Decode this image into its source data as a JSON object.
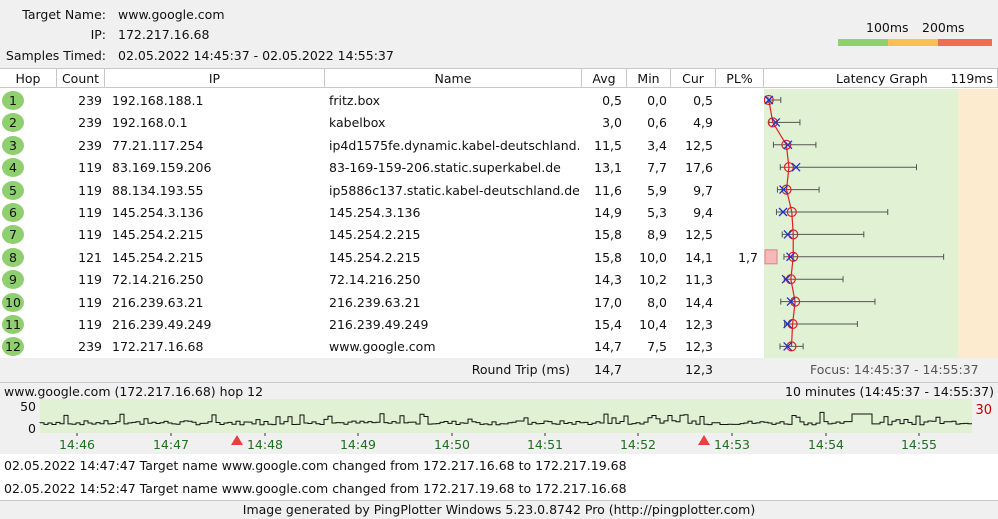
{
  "header": {
    "target_label": "Target Name:",
    "target_value": "www.google.com",
    "ip_label": "IP:",
    "ip_value": "172.217.16.68",
    "samples_label": "Samples Timed:",
    "samples_value": "02.05.2022 14:45:37 - 02.05.2022 14:55:37"
  },
  "legend": {
    "label_100": "100ms",
    "label_200": "200ms",
    "colors": [
      "#8fcf70",
      "#f9c154",
      "#f36b50"
    ]
  },
  "columns": {
    "hop": "Hop",
    "count": "Count",
    "ip": "IP",
    "name": "Name",
    "avg": "Avg",
    "min": "Min",
    "cur": "Cur",
    "pl": "PL%",
    "graph": "Latency Graph",
    "graph_max": "119ms"
  },
  "hops": [
    {
      "hop": "1",
      "count": "239",
      "ip": "192.168.188.1",
      "name": "fritz.box",
      "avg": "0,5",
      "min": "0,0",
      "cur": "0,5",
      "pl": "",
      "avg_ms": 0.5,
      "min_ms": 0.0,
      "cur_ms": 0.5,
      "max_ms": 8
    },
    {
      "hop": "2",
      "count": "239",
      "ip": "192.168.0.1",
      "name": "kabelbox",
      "avg": "3,0",
      "min": "0,6",
      "cur": "4,9",
      "pl": "",
      "avg_ms": 3.0,
      "min_ms": 0.6,
      "cur_ms": 4.9,
      "max_ms": 20
    },
    {
      "hop": "3",
      "count": "239",
      "ip": "77.21.117.254",
      "name": "ip4d1575fe.dynamic.kabel-deutschland.",
      "avg": "11,5",
      "min": "3,4",
      "cur": "12,5",
      "pl": "",
      "avg_ms": 11.5,
      "min_ms": 3.4,
      "cur_ms": 12.5,
      "max_ms": 30
    },
    {
      "hop": "4",
      "count": "119",
      "ip": "83.169.159.206",
      "name": "83-169-159-206.static.superkabel.de",
      "avg": "13,1",
      "min": "7,7",
      "cur": "17,6",
      "pl": "",
      "avg_ms": 13.1,
      "min_ms": 7.7,
      "cur_ms": 17.6,
      "max_ms": 93
    },
    {
      "hop": "5",
      "count": "119",
      "ip": "88.134.193.55",
      "name": "ip5886c137.static.kabel-deutschland.de",
      "avg": "11,6",
      "min": "5,9",
      "cur": "9,7",
      "pl": "",
      "avg_ms": 11.6,
      "min_ms": 5.9,
      "cur_ms": 9.7,
      "max_ms": 32
    },
    {
      "hop": "6",
      "count": "119",
      "ip": "145.254.3.136",
      "name": "145.254.3.136",
      "avg": "14,9",
      "min": "5,3",
      "cur": "9,4",
      "pl": "",
      "avg_ms": 14.9,
      "min_ms": 5.3,
      "cur_ms": 9.4,
      "max_ms": 75
    },
    {
      "hop": "7",
      "count": "119",
      "ip": "145.254.2.215",
      "name": "145.254.2.215",
      "avg": "15,8",
      "min": "8,9",
      "cur": "12,5",
      "pl": "",
      "avg_ms": 15.8,
      "min_ms": 8.9,
      "cur_ms": 12.5,
      "max_ms": 60
    },
    {
      "hop": "8",
      "count": "121",
      "ip": "145.254.2.215",
      "name": "145.254.2.215",
      "avg": "15,8",
      "min": "10,0",
      "cur": "14,1",
      "pl": "1,7",
      "avg_ms": 15.8,
      "min_ms": 10.0,
      "cur_ms": 14.1,
      "max_ms": 110
    },
    {
      "hop": "9",
      "count": "119",
      "ip": "72.14.216.250",
      "name": "72.14.216.250",
      "avg": "14,3",
      "min": "10,2",
      "cur": "11,3",
      "pl": "",
      "avg_ms": 14.3,
      "min_ms": 10.2,
      "cur_ms": 11.3,
      "max_ms": 47
    },
    {
      "hop": "10",
      "count": "119",
      "ip": "216.239.63.21",
      "name": "216.239.63.21",
      "avg": "17,0",
      "min": "8,0",
      "cur": "14,4",
      "pl": "",
      "avg_ms": 17.0,
      "min_ms": 8.0,
      "cur_ms": 14.4,
      "max_ms": 67
    },
    {
      "hop": "11",
      "count": "119",
      "ip": "216.239.49.249",
      "name": "216.239.49.249",
      "avg": "15,4",
      "min": "10,4",
      "cur": "12,3",
      "pl": "",
      "avg_ms": 15.4,
      "min_ms": 10.4,
      "cur_ms": 12.3,
      "max_ms": 56
    },
    {
      "hop": "12",
      "count": "239",
      "ip": "172.217.16.68",
      "name": "www.google.com",
      "avg": "14,7",
      "min": "7,5",
      "cur": "12,3",
      "pl": "",
      "avg_ms": 14.7,
      "min_ms": 7.5,
      "cur_ms": 12.3,
      "max_ms": 22
    }
  ],
  "round_trip": {
    "label": "Round Trip (ms)",
    "avg": "14,7",
    "cur": "12,3",
    "focus": "Focus: 14:45:37 - 14:55:37"
  },
  "timeline": {
    "title": "www.google.com (172.217.16.68) hop 12",
    "range": "10 minutes (14:45:37 - 14:55:37)",
    "y_top": "50",
    "y_bottom": "0",
    "right_value": "30",
    "ticks": [
      "14:46",
      "14:47",
      "14:48",
      "14:49",
      "14:50",
      "14:51",
      "14:52",
      "14:53",
      "14:54",
      "14:55"
    ],
    "alerts_at": [
      "14:48",
      "14:53"
    ]
  },
  "chart_data": {
    "type": "line",
    "title": "Latency Graph",
    "xlabel": "",
    "ylabel": "",
    "xlim": [
      0,
      119
    ],
    "categories": [
      "1",
      "2",
      "3",
      "4",
      "5",
      "6",
      "7",
      "8",
      "9",
      "10",
      "11",
      "12"
    ],
    "series": [
      {
        "name": "Avg",
        "values": [
          0.5,
          3.0,
          11.5,
          13.1,
          11.6,
          14.9,
          15.8,
          15.8,
          14.3,
          17.0,
          15.4,
          14.7
        ]
      },
      {
        "name": "Min",
        "values": [
          0.0,
          0.6,
          3.4,
          7.7,
          5.9,
          5.3,
          8.9,
          10.0,
          10.2,
          8.0,
          10.4,
          7.5
        ]
      },
      {
        "name": "Cur",
        "values": [
          0.5,
          4.9,
          12.5,
          17.6,
          9.7,
          9.4,
          12.5,
          14.1,
          11.3,
          14.4,
          12.3,
          12.3
        ]
      }
    ]
  },
  "events": [
    "02.05.2022 14:47:47 Target name www.google.com changed from 172.217.16.68 to 172.217.19.68",
    "02.05.2022 14:52:47 Target name www.google.com changed from 172.217.19.68 to 172.217.16.68"
  ],
  "footer": "Image generated by PingPlotter Windows 5.23.0.8742 Pro (http://pingplotter.com)"
}
